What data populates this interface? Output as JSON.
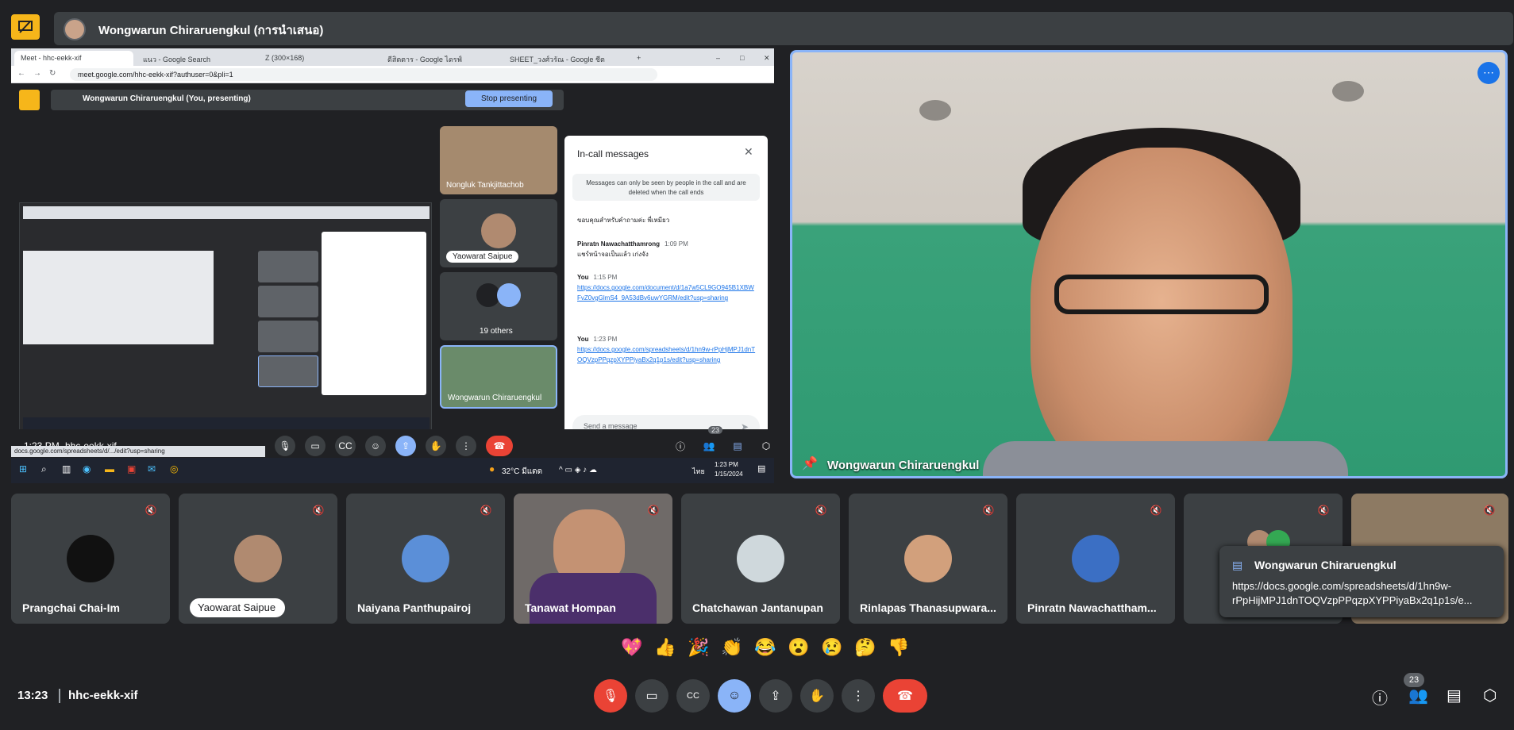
{
  "presenter": {
    "title": "Wongwarun Chiraruengkul (การนำเสนอ)"
  },
  "browser": {
    "tabs": [
      "Meet - hhc-eekk-xif",
      "แนว - Google Search",
      "Z (300×168)",
      "ดีสิตตาร - Google ไดรฟ์",
      "SHEET_วงศ์วรัณ - Google ชีต"
    ],
    "url": "meet.google.com/hhc-eekk-xif?authuser=0&pli=1"
  },
  "inner_meet": {
    "presenting_label": "Wongwarun Chiraruengkul (You, presenting)",
    "stop_button": "Stop presenting",
    "tiles": [
      "Nongluk Tankjittachob",
      "Yaowarat Saipue",
      "19 others",
      "Wongwarun Chiraruengkul"
    ],
    "time": "1:23 PM",
    "code": "hhc-eekk-xif",
    "people_count": "23",
    "status_url": "docs.google.com/spreadsheets/d/.../edit?usp=sharing"
  },
  "chat": {
    "title": "In-call messages",
    "note": "Messages can only be seen by people in the call and are deleted when the call ends",
    "messages": [
      {
        "sender": "",
        "time": "",
        "text": "ขอบคุณสำหรับคำถามค่ะ พี่เหมียว",
        "link": ""
      },
      {
        "sender": "Pinratn Nawachatthamrong",
        "time": "1:09 PM",
        "text": "แชร์หน้าจอเป็นแล้ว เก่งจัง",
        "link": ""
      },
      {
        "sender": "You",
        "time": "1:15 PM",
        "text": "",
        "link": "https://docs.google.com/document/d/1a7w5CL9GO945B1XBWFvZ0vgGlmS4_9A53dBv6uwYGRM/edit?usp=sharing"
      },
      {
        "sender": "You",
        "time": "1:23 PM",
        "text": "",
        "link": "https://docs.google.com/spreadsheets/d/1hn9w-rPpHjMPJ1dnTOQVzpPPqzpXYPPiyaBx2q1p1s/edit?usp=sharing"
      }
    ],
    "input_placeholder": "Send a message"
  },
  "taskbar": {
    "weather": "32°C มีแดด",
    "time": "1:23 PM",
    "date": "1/15/2024",
    "lang": "ไทย"
  },
  "speaker": {
    "name": "Wongwarun Chiraruengkul"
  },
  "participants": [
    {
      "name": "Prangchai Chai-Im",
      "muted": true
    },
    {
      "name": "Yaowarat Saipue",
      "muted": true
    },
    {
      "name": "Naiyana Panthupairoj",
      "muted": true
    },
    {
      "name": "Tanawat Hompan",
      "muted": true
    },
    {
      "name": "Chatchawan Jantanupan",
      "muted": true
    },
    {
      "name": "Rinlapas Thanasupwara...",
      "muted": true
    },
    {
      "name": "Pinratn Nawachattham...",
      "muted": true
    }
  ],
  "popup": {
    "sender": "Wongwarun Chiraruengkul",
    "text": "https://docs.google.com/spreadsheets/d/1hn9w-rPpHijMPJ1dnTOQVzpPPqzpXYPPiyaBx2q1p1s/e..."
  },
  "reactions": [
    "💖",
    "👍",
    "🎉",
    "👏",
    "😂",
    "😮",
    "😢",
    "🤔",
    "👎"
  ],
  "bottom": {
    "time": "13:23",
    "code": "hhc-eekk-xif",
    "people_count": "23"
  }
}
